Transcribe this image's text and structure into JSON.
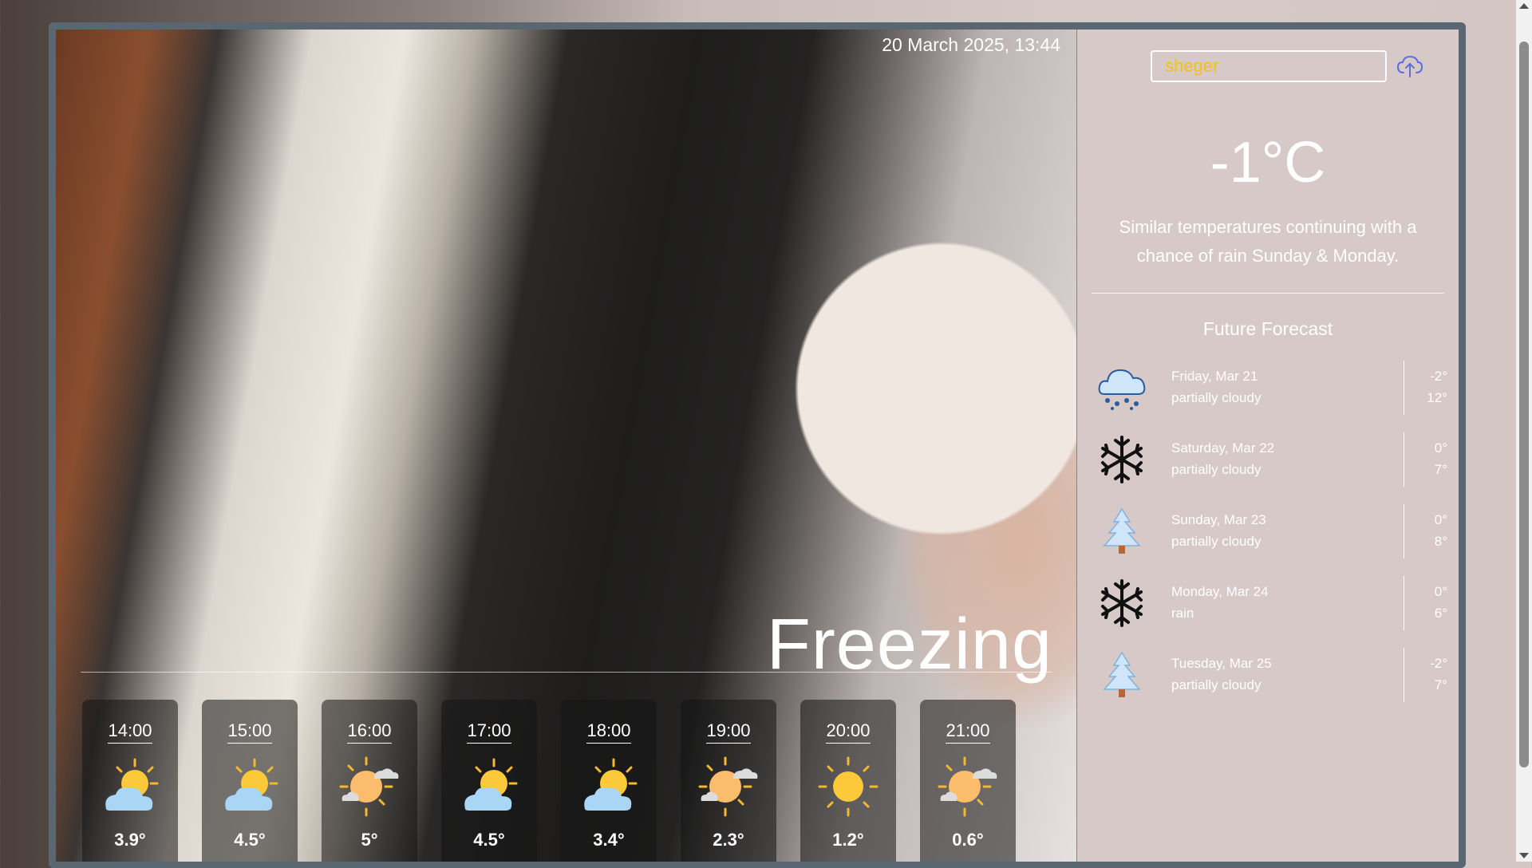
{
  "header": {
    "date_time": "20 March 2025, 13:44"
  },
  "main": {
    "condition": "Freezing"
  },
  "hourly": [
    {
      "time": "14:00",
      "temp": "3.9°",
      "icon": "sun-behind-cloud-icon"
    },
    {
      "time": "15:00",
      "temp": "4.5°",
      "icon": "sun-behind-cloud-icon"
    },
    {
      "time": "16:00",
      "temp": "5°",
      "icon": "sun-small-cloud-icon"
    },
    {
      "time": "17:00",
      "temp": "4.5°",
      "icon": "sun-behind-cloud-icon"
    },
    {
      "time": "18:00",
      "temp": "3.4°",
      "icon": "sun-behind-cloud-icon"
    },
    {
      "time": "19:00",
      "temp": "2.3°",
      "icon": "sun-small-cloud-icon"
    },
    {
      "time": "20:00",
      "temp": "1.2°",
      "icon": "sun-icon"
    },
    {
      "time": "21:00",
      "temp": "0.6°",
      "icon": "sun-small-cloud-icon"
    }
  ],
  "search": {
    "value": "sheger",
    "placeholder": ""
  },
  "current": {
    "temp": "-1°C",
    "summary": "Similar temperatures continuing with a chance of rain Sunday & Monday."
  },
  "forecast": {
    "title": "Future Forecast",
    "items": [
      {
        "day": "Friday, Mar 21",
        "desc": "partially cloudy",
        "low": "-2°",
        "high": "12°",
        "icon": "snow-cloud-icon"
      },
      {
        "day": "Saturday, Mar 22",
        "desc": "partially cloudy",
        "low": "0°",
        "high": "7°",
        "icon": "snowflake-icon"
      },
      {
        "day": "Sunday, Mar 23",
        "desc": "partially cloudy",
        "low": "0°",
        "high": "8°",
        "icon": "snowy-tree-icon"
      },
      {
        "day": "Monday, Mar 24",
        "desc": "rain",
        "low": "0°",
        "high": "6°",
        "icon": "snowflake-icon"
      },
      {
        "day": "Tuesday, Mar 25",
        "desc": "partially cloudy",
        "low": "-2°",
        "high": "7°",
        "icon": "snowy-tree-icon"
      }
    ]
  },
  "colors": {
    "search_text": "#f1c40f",
    "upload_icon": "#5b6ee1",
    "frame": "#5b6770"
  }
}
